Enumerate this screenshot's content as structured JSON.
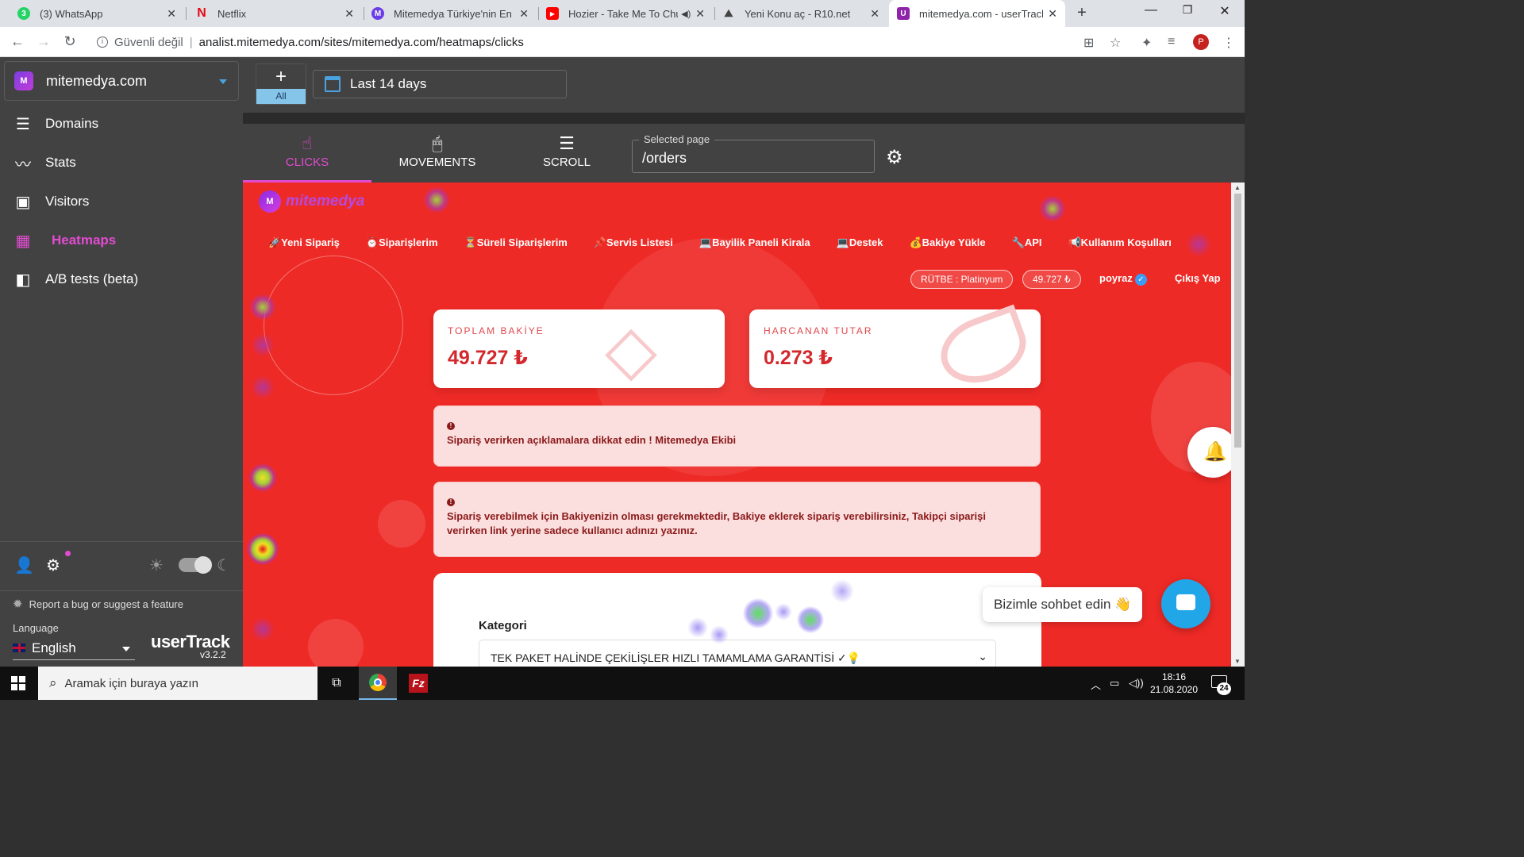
{
  "browser": {
    "tabs": [
      {
        "title": "(3) WhatsApp",
        "icon": "whatsapp-icon",
        "color": "#25d366",
        "glyph": "3"
      },
      {
        "title": "Netflix",
        "icon": "netflix-icon",
        "color": "#e50914",
        "glyph": "N"
      },
      {
        "title": "Mitemedya Türkiye'nin En Bü",
        "icon": "mitemedya-icon",
        "color": "#6a3de8",
        "glyph": "M"
      },
      {
        "title": "Hozier - Take Me To Chur",
        "icon": "youtube-icon",
        "color": "#ff0000",
        "glyph": "▶"
      },
      {
        "title": "Yeni Konu aç - R10.net",
        "icon": "r10-icon",
        "color": "#444444",
        "glyph": "R"
      },
      {
        "title": "mitemedya.com - userTrack",
        "icon": "usertrack-icon",
        "color": "#8e24aa",
        "glyph": "U"
      }
    ],
    "new_tab_glyph": "+",
    "secure_label": "Güvenli değil",
    "url": "analist.mitemedya.com/sites/mitemedya.com/heatmaps/clicks",
    "profile_initial": "P"
  },
  "sidebar": {
    "site": "mitemedya.com",
    "items": [
      {
        "label": "Domains",
        "icon": "list-icon",
        "glyph": "☰"
      },
      {
        "label": "Stats",
        "icon": "trend-icon",
        "glyph": "〰"
      },
      {
        "label": "Visitors",
        "icon": "visitors-icon",
        "glyph": "▣"
      },
      {
        "label": "Heatmaps",
        "icon": "heatmap-icon",
        "glyph": "▦"
      },
      {
        "label": "A/B tests (beta)",
        "icon": "ab-test-icon",
        "glyph": "◧"
      }
    ],
    "report": "Report a bug or suggest a feature",
    "language_label": "Language",
    "language": "English",
    "brand": "userTrack",
    "version": "v3.2.2"
  },
  "toolbar": {
    "add_label": "+",
    "all_label": "All",
    "date_range": "Last 14 days"
  },
  "modes": [
    {
      "label": "CLICKS",
      "glyph": "☝"
    },
    {
      "label": "MOVEMENTS",
      "glyph": "🖱"
    },
    {
      "label": "SCROLL",
      "glyph": "☰"
    }
  ],
  "selected_page": {
    "legend": "Selected page",
    "value": "/orders"
  },
  "site": {
    "logo_text": "mitemedya",
    "logo_mark": "M",
    "nav": [
      "🚀Yeni Sipariş",
      "⏰Siparişlerim",
      "⏳Süreli Siparişlerim",
      "📌Servis Listesi",
      "💻Bayilik Paneli Kirala",
      "💻Destek",
      "💰Bakiye Yükle",
      "🔧API",
      "📢Kullanım Koşulları"
    ],
    "rank": "RÜTBE : Platinyum",
    "balance_badge": "49.727 ₺",
    "username": "poyraz",
    "logout": "Çıkış Yap",
    "cards": [
      {
        "label": "TOPLAM BAKİYE",
        "value": "49.727 ₺"
      },
      {
        "label": "HARCANAN TUTAR",
        "value": "0.273 ₺"
      }
    ],
    "alert1": "Sipariş verirken açıklamalara dikkat edin ! Mitemedya Ekibi",
    "alert2_line1": "Sipariş verebilmek için Bakiyenizin olması gerekmektedir, Bakiye eklerek sipariş verebilirsiniz, Takipçi siparişi",
    "alert2_line2": "verirken link yerine sadece kullanıcı adınızı yazınız.",
    "category_label": "Kategori",
    "category_value": "TEK PAKET HALİNDE ÇEKİLİŞLER HIZLI TAMAMLAMA GARANTİSİ ✓💡",
    "chat_text": "Bizimle sohbet edin 👋"
  },
  "taskbar": {
    "search_placeholder": "Aramak için buraya yazın",
    "time": "18:16",
    "date": "21.08.2020",
    "notifications": "24"
  },
  "colors": {
    "accent": "#e24bd1",
    "site_red": "#ee2a26",
    "sidebar_bg": "#424242"
  }
}
